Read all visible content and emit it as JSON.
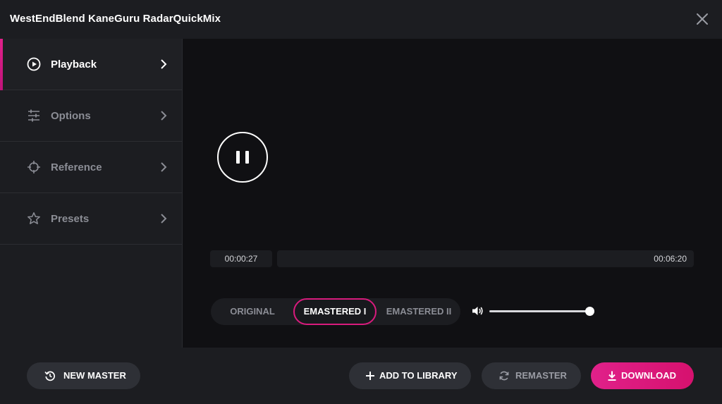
{
  "window": {
    "title": "WestEndBlend KaneGuru RadarQuickMix"
  },
  "sidebar": {
    "items": [
      {
        "label": "Playback",
        "icon": "play-circle-icon",
        "active": true
      },
      {
        "label": "Options",
        "icon": "sliders-icon",
        "active": false
      },
      {
        "label": "Reference",
        "icon": "crosshair-icon",
        "active": false
      },
      {
        "label": "Presets",
        "icon": "star-icon",
        "active": false
      }
    ]
  },
  "player": {
    "state": "playing",
    "current_time": "00:00:27",
    "total_time": "00:06:20",
    "versions": [
      "ORIGINAL",
      "EMASTERED I",
      "EMASTERED II"
    ],
    "selected_version": "EMASTERED I",
    "volume": 1.0
  },
  "footer": {
    "new_master": "NEW MASTER",
    "add_to_library": "ADD TO LIBRARY",
    "remaster": "REMASTER",
    "download": "DOWNLOAD"
  },
  "colors": {
    "accent": "#e0218a",
    "wave_start": "#4fc3f7",
    "wave_mid": "#5a4fcf",
    "wave_end": "#b21fb0"
  }
}
